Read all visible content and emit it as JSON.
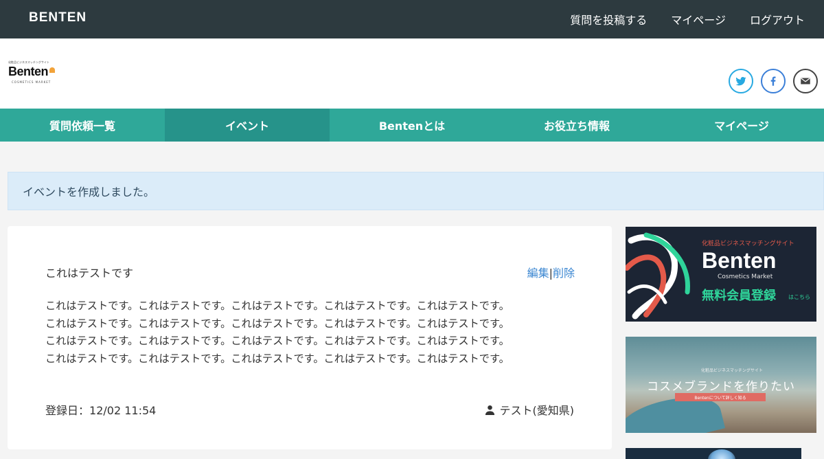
{
  "topbar": {
    "brand": "BENTEN",
    "nav": [
      "質問を投稿する",
      "マイページ",
      "ログアウト"
    ]
  },
  "header": {
    "logo_tagline": "化粧品ビジネスマッチングサイト",
    "logo_word": "Benten",
    "logo_sub": "COSMETICS MARKET",
    "social_icons": [
      "twitter-icon",
      "facebook-icon",
      "mail-icon"
    ]
  },
  "main_nav": {
    "items": [
      "質問依頼一覧",
      "イベント",
      "Bentenとは",
      "お役立ち情報",
      "マイページ"
    ],
    "active_index": 1
  },
  "alert": {
    "message": "イベントを作成しました。"
  },
  "event": {
    "title": "これはテストです",
    "edit_label": "編集",
    "separator": "|",
    "delete_label": "削除",
    "body_lines": [
      "これはテストです。これはテストです。これはテストです。これはテストです。これはテストです。",
      "これはテストです。これはテストです。これはテストです。これはテストです。これはテストです。",
      "これはテストです。これはテストです。これはテストです。これはテストです。これはテストです。",
      "これはテストです。これはテストです。これはテストです。これはテストです。これはテストです。"
    ],
    "date_label": "登録日：",
    "date_value": "12/02 11:54",
    "author": "テスト(愛知県)"
  },
  "sidebar": {
    "banner1": {
      "tagline": "化粧品ビジネスマッチングサイト",
      "title": "Benten",
      "subtitle": "Cosmetics Market",
      "cta": "無料会員登録",
      "cta_suffix": "はこちら"
    },
    "banner2": {
      "tagline": "化粧品ビジネスマッチングサイト",
      "title": "コスメブランドを作りたい",
      "button": "Bentenについて詳しく知る"
    }
  },
  "colors": {
    "topbar": "#2d3a3f",
    "nav": "#2fa899",
    "nav_active": "#26938a",
    "alert_bg": "#dbecf9",
    "link": "#3a86d1"
  }
}
